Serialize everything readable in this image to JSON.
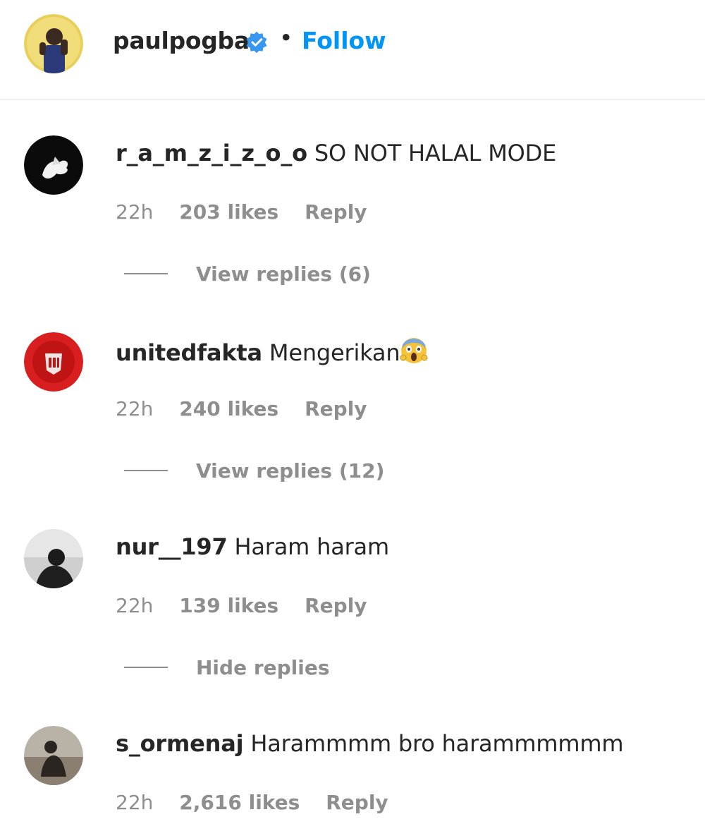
{
  "post": {
    "username": "paulpogba",
    "separator": "•",
    "follow_label": "Follow",
    "verified_icon": "verified-badge-icon",
    "accent_color": "#0095f6"
  },
  "comments": [
    {
      "username": "r_a_m_z_i_z_o_o",
      "text": "SO NOT HALAL MODE",
      "time": "22h",
      "likes": "203 likes",
      "reply_label": "Reply",
      "replies_label": "View replies (6)"
    },
    {
      "username": "unitedfakta",
      "text": "Mengerikan",
      "emoji": "face-screaming-in-fear-icon",
      "time": "22h",
      "likes": "240 likes",
      "reply_label": "Reply",
      "replies_label": "View replies (12)"
    },
    {
      "username": "nur__197",
      "text": "Haram haram",
      "time": "22h",
      "likes": "139 likes",
      "reply_label": "Reply",
      "replies_label": "Hide replies"
    },
    {
      "username": "s_ormenaj",
      "text": "Harammmm bro harammmmmm",
      "time": "22h",
      "likes": "2,616 likes",
      "reply_label": "Reply"
    }
  ]
}
